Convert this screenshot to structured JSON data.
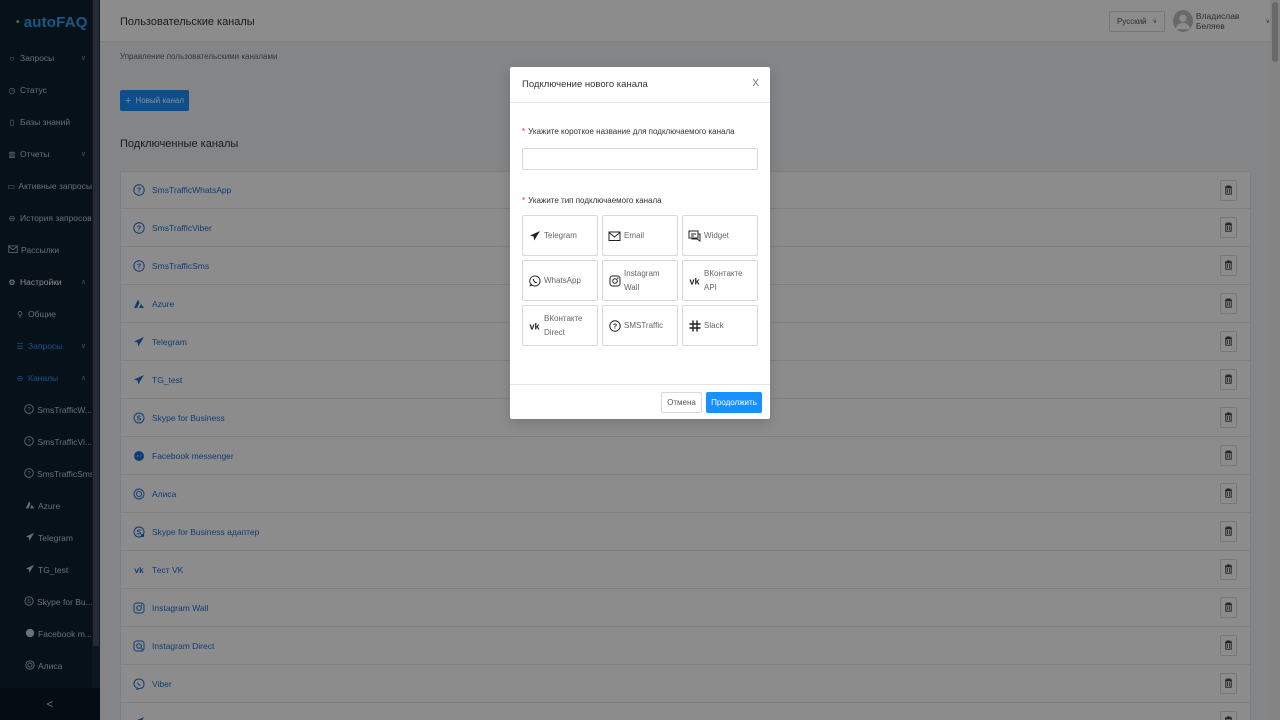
{
  "app": {
    "logo": "autoFAQ"
  },
  "sidebar": {
    "items": [
      {
        "label": "Запросы",
        "icon": "chat-icon",
        "chevron": "v"
      },
      {
        "label": "Статус",
        "icon": "clock-icon"
      },
      {
        "label": "Базы знаний",
        "icon": "book-icon"
      },
      {
        "label": "Отчеты",
        "icon": "chart-icon",
        "chevron": "v"
      },
      {
        "label": "Активные запросы",
        "icon": "message-icon"
      },
      {
        "label": "История запросов",
        "icon": "history-icon"
      },
      {
        "label": "Рассылки",
        "icon": "mail-icon"
      },
      {
        "label": "Настройки",
        "icon": "gear-icon",
        "chevron": "^"
      },
      {
        "label": "Общие",
        "icon": "settings-icon"
      },
      {
        "label": "Запросы",
        "icon": "list-icon",
        "chevron": "v"
      },
      {
        "label": "Каналы",
        "icon": "channels-icon",
        "chevron": "^"
      },
      {
        "label": "SmsTrafficW...",
        "icon": "question-icon"
      },
      {
        "label": "SmsTrafficVi...",
        "icon": "question-icon"
      },
      {
        "label": "SmsTrafficSms",
        "icon": "question-icon"
      },
      {
        "label": "Azure",
        "icon": "azure-icon"
      },
      {
        "label": "Telegram",
        "icon": "telegram-icon"
      },
      {
        "label": "TG_test",
        "icon": "telegram-icon"
      },
      {
        "label": "Skype for Bu...",
        "icon": "skype-icon"
      },
      {
        "label": "Facebook m...",
        "icon": "messenger-icon"
      },
      {
        "label": "Алиса",
        "icon": "alice-icon"
      }
    ],
    "collapse_glyph": "<"
  },
  "header": {
    "title": "Пользовательские каналы",
    "language": "Русский",
    "user_name": "Владислав Беляев"
  },
  "content": {
    "subtitle": "Управление пользовательскими каналами",
    "new_channel_button": "Новый канал",
    "section_title": "Подключенные каналы",
    "channels": [
      {
        "label": "SmsTrafficWhatsApp",
        "icon": "question-icon"
      },
      {
        "label": "SmsTrafficViber",
        "icon": "question-icon"
      },
      {
        "label": "SmsTrafficSms",
        "icon": "question-icon"
      },
      {
        "label": "Azure",
        "icon": "azure-icon"
      },
      {
        "label": "Telegram",
        "icon": "telegram-icon"
      },
      {
        "label": "TG_test",
        "icon": "telegram-icon"
      },
      {
        "label": "Skype for Business",
        "icon": "skype-icon"
      },
      {
        "label": "Facebook messenger",
        "icon": "messenger-icon"
      },
      {
        "label": "Алиса",
        "icon": "alice-icon"
      },
      {
        "label": "Skype for Business адаптер",
        "icon": "skype-adapter-icon"
      },
      {
        "label": "Тест VK",
        "icon": "vk-icon"
      },
      {
        "label": "Instagram Wall",
        "icon": "instagram-icon"
      },
      {
        "label": "Instagram Direct",
        "icon": "instagram-direct-icon"
      },
      {
        "label": "Viber",
        "icon": "viber-icon"
      },
      {
        "label": "",
        "icon": "telegram-icon"
      }
    ]
  },
  "modal": {
    "title": "Подключение нового канала",
    "close_glyph": "X",
    "name_label": "Укажите короткое название для подключаемого канала",
    "name_value": "",
    "name_placeholder": "",
    "type_label": "Укажите тип подключаемого канала",
    "types": [
      {
        "label": "Telegram",
        "icon": "telegram-icon"
      },
      {
        "label": "Email",
        "icon": "mail-icon"
      },
      {
        "label": "Widget",
        "icon": "widget-icon"
      },
      {
        "label": "WhatsApp",
        "icon": "whatsapp-icon"
      },
      {
        "label": "Instagram Wall",
        "icon": "instagram-icon"
      },
      {
        "label": "ВКонтакте API",
        "icon": "vk-icon"
      },
      {
        "label": "ВКонтакте Direct",
        "icon": "vk-icon"
      },
      {
        "label": "SMSTraffic",
        "icon": "question-icon"
      },
      {
        "label": "Slack",
        "icon": "slack-icon"
      }
    ],
    "cancel_button": "Отмена",
    "continue_button": "Продолжить"
  },
  "colors": {
    "primary": "#1890ff",
    "sidebar": "#0c1f31",
    "link": "#1d6fd1"
  }
}
